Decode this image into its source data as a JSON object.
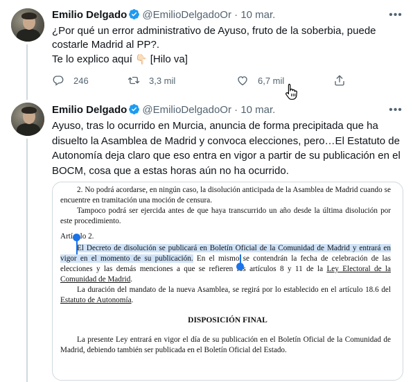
{
  "colors": {
    "accent": "#1d9bf0",
    "muted": "#536471",
    "text": "#0f1419",
    "highlight": "#cfe2f7"
  },
  "tweets": [
    {
      "author": {
        "name": "Emilio Delgado",
        "handle": "@EmilioDelgadoOr"
      },
      "dot": "·",
      "time": "10 mar.",
      "text_line1": "¿Por qué un error administrativo de Ayuso, fruto de la soberbia, puede costarle Madrid al PP?.",
      "text_line2": "Te lo explico aquí",
      "text_line2_end": "[Hilo va]",
      "emoji": "👇🏻",
      "actions": {
        "replies": "246",
        "retweets": "3,3 mil",
        "likes": "6,7 mil"
      }
    },
    {
      "author": {
        "name": "Emilio Delgado",
        "handle": "@EmilioDelgadoOr"
      },
      "dot": "·",
      "time": "10 mar.",
      "text": "Ayuso, tras lo ocurrido en Murcia, anuncia de forma precipitada que ha disuelto la Asamblea de Madrid y convoca elecciones, pero…El Estatuto de Autonomía deja claro que eso entra en vigor a partir de su publicación en el BOCM, cosa que a estas horas aún no ha ocurrido.",
      "document": {
        "p1": "2. No podrá acordarse, en ningún caso, la disolución anticipada de la Asamblea de Madrid cuando se encuentre en tramitación una moción de censura.",
        "p2": "Tampoco podrá ser ejercida antes de que haya transcurrido un año desde la última disolución por este procedimiento.",
        "article": "Artículo 2.",
        "p3_highlight": "El Decreto de disolución se publicará en Boletín Oficial de la Comunidad de Madrid y entrará en vigor en el momento de su publicación.",
        "p3_rest": " En el mismo se contendrán la fecha de celebración de las elecciones y las demás menciones a que se refieren los artículos 8 y 11 de la ",
        "p3_link": "Ley Electoral de la Comunidad de Madrid",
        "p3_end": ".",
        "p4_start": "La duración del mandato de la nueva Asamblea, se regirá por lo establecido en el artículo 18.6 del ",
        "p4_link": "Estatuto de Autonomía",
        "p4_end": ".",
        "final_title": "DISPOSICIÓN FINAL",
        "p5": "La presente Ley entrará en vigor el día de su publicación en el Boletín Oficial de la Comunidad de Madrid, debiendo también ser publicada en el Boletín Oficial del Estado."
      }
    }
  ],
  "icons": {
    "more": "more-icon",
    "reply": "reply-icon",
    "retweet": "retweet-icon",
    "like": "like-icon",
    "share": "share-icon",
    "verified": "verified-badge-icon"
  }
}
